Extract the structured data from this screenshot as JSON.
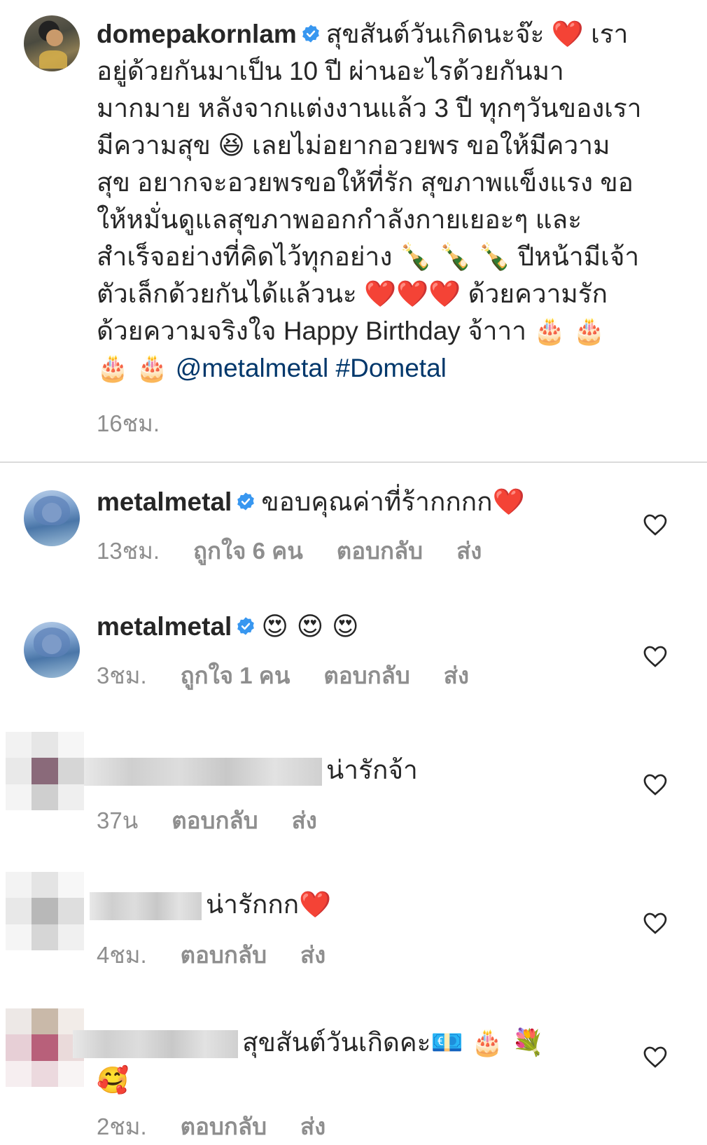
{
  "post": {
    "username": "domepakornlam",
    "caption_lines": [
      "สุขสันต์วันเกิดนะจ๊ะ ",
      " เรา",
      "อยู่ด้วยกันมาเป็น 10 ปี ผ่านอะไรด้วยกันมา",
      "มากมาย หลังจากแต่งงานแล้ว 3 ปี ทุกๆวันของเรา",
      "มีความสุข ",
      " เลยไม่อยากอวยพร ขอให้มีความ",
      "สุข อยากจะอวยพรขอให้ที่รัก สุขภาพแข็งแรง ขอ",
      "ให้หมั่นดูแลสุขภาพออกกำลังกายเยอะๆ และ",
      "สำเร็จอย่างที่คิดไว้ทุกอย่าง ",
      " ปีหน้ามีเจ้า",
      "ตัวเล็กด้วยกันได้แล้วนะ ",
      " ด้วยความรัก",
      "ด้วยความจริงใจ  Happy Birthday จ้าาา "
    ],
    "emojis": {
      "heart": "❤️",
      "grin": "😆",
      "bottle": "🍾",
      "cake": "🎂"
    },
    "mention": "@metalmetal",
    "hashtag": "#Dometal",
    "time": "16ชม."
  },
  "comments": [
    {
      "username": "metalmetal",
      "verified": true,
      "text": "ขอบคุณค่าที่ร้ากกกก",
      "emoji": "❤️",
      "time": "13ชม.",
      "likes": "ถูกใจ 6 คน",
      "reply": "ตอบกลับ",
      "send": "ส่ง"
    },
    {
      "username": "metalmetal",
      "verified": true,
      "text": "",
      "emoji": "😍 😍 😍",
      "time": "3ชม.",
      "likes": "ถูกใจ 1 คน",
      "reply": "ตอบกลับ",
      "send": "ส่ง"
    },
    {
      "text": "น่ารักจ้า",
      "time": "37น",
      "reply": "ตอบกลับ",
      "send": "ส่ง"
    },
    {
      "text": "น่ารักกก",
      "emoji": "❤️",
      "time": "4ชม.",
      "reply": "ตอบกลับ",
      "send": "ส่ง"
    },
    {
      "text": "สุขสันต์วันเกิดคะ",
      "emoji": "💶 🎂 💐",
      "emoji2": "🥰",
      "time": "2ชม.",
      "reply": "ตอบกลับ",
      "send": "ส่ง"
    }
  ],
  "colors": {
    "text": "#262626",
    "secondary": "#8e8e8e",
    "link": "#00376b",
    "verified": "#3897f0",
    "divider": "#dbdbdb"
  }
}
